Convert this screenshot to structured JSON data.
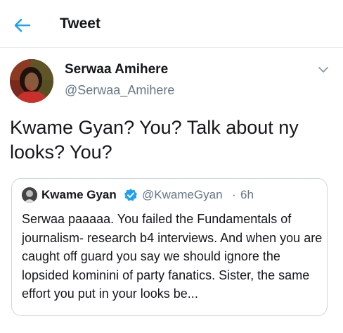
{
  "header": {
    "title": "Tweet",
    "back_icon": "arrow-left-icon",
    "accent_color": "#1da1f2"
  },
  "tweet": {
    "author_name": "Serwaa Amihere",
    "author_handle": "@Serwaa_Amihere",
    "text": "Kwame Gyan? You? Talk about ny looks? You?",
    "menu_icon": "chevron-down-icon"
  },
  "quoted_tweet": {
    "author_name": "Kwame Gyan",
    "verified_icon": "verified-badge-icon",
    "author_handle": "@KwameGyan",
    "separator": "·",
    "time": "6h",
    "text": "Serwaa paaaaa. You failed the Fundamentals of journalism- research b4 interviews. And when you are caught off guard you say we should ignore the lopsided kominini of party fanatics. Sister, the same effort you put in your looks be..."
  }
}
